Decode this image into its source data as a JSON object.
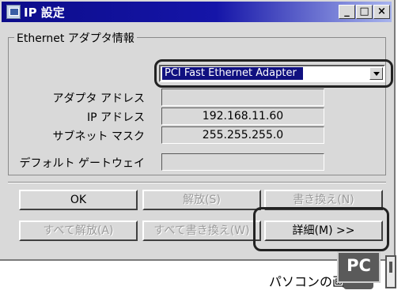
{
  "window": {
    "title": "IP 設定",
    "minimize_glyph": "_",
    "maximize_glyph": "□",
    "close_glyph": "×"
  },
  "group": {
    "legend": "Ethernet アダプタ情報",
    "adapter_select": {
      "value": "PCI Fast Ethernet Adapter"
    }
  },
  "fields": [
    {
      "label": "アダプタ アドレス",
      "value": ""
    },
    {
      "label": "IP アドレス",
      "value": "192.168.11.60"
    },
    {
      "label": "サブネット マスク",
      "value": "255.255.255.0"
    },
    {
      "label": "デフォルト ゲートウェイ",
      "value": ""
    }
  ],
  "buttons": {
    "ok": "OK",
    "release": "解放(S)",
    "renew": "書き換え(N)",
    "release_all": "すべて解放(A)",
    "renew_all": "すべて書き換え(W)",
    "details": "詳細(M) >>"
  },
  "caption": "パソコンの画面",
  "badge": "PC",
  "colors": {
    "titlebar": "#0c0c8a",
    "face": "#d9d9d9",
    "selection": "#101080"
  }
}
